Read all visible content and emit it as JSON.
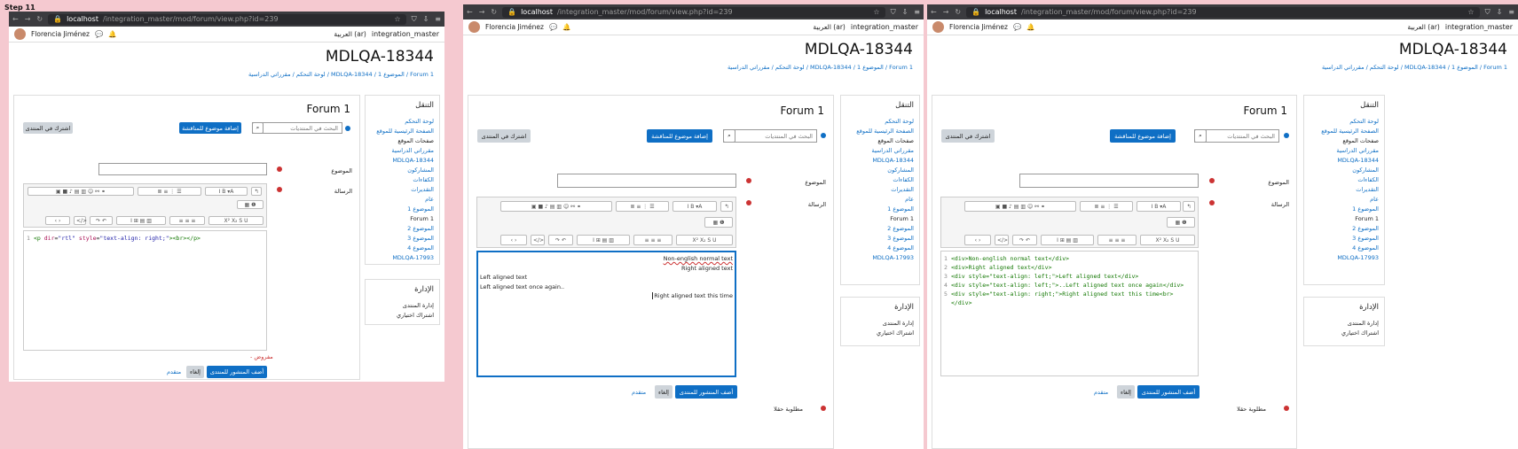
{
  "step_label": "Step 11",
  "browser": {
    "host": "localhost",
    "path": "/integration_master/mod/forum/view.php?id=239"
  },
  "user": {
    "name": "Florencia Jiménez"
  },
  "lang": "العربية (ar)",
  "site_name": "integration_master",
  "course_name": "MDLQA-18344",
  "breadcrumb": "لوحة التحكم / مقرراتي الدراسية / MDLQA-18344 / الموضوع 1 / Forum 1",
  "forum_title": "Forum 1",
  "search_placeholder": "البحث في المنتديات",
  "add_discussion": "إضافة موضوع للمناقشة",
  "subscribe": "اشترك في المنتدى",
  "subject_label": "الموضوع",
  "message_label": "الرسالة",
  "required_note": "- مفروض",
  "required_fields": "مطلوبة حقلا",
  "post_button": "أضف المنشور للمنتدى",
  "cancel_button": "إلغاء",
  "advanced_link": "متقدم",
  "nav_block": {
    "title": "التنقل",
    "items": [
      "لوحة التحكم",
      "الصفحة الرئيسية للموقع",
      "صفحات الموقع",
      "مقرراتي الدراسية",
      "MDLQA-18344",
      "المشاركون",
      "الكفاءات",
      "التقديرات",
      "عام",
      "الموضوع 1",
      "Forum 1",
      "الموضوع 2",
      "الموضوع 3",
      "الموضوع 4",
      "MDLQA-17993"
    ]
  },
  "admin_block": {
    "title": "الإدارة",
    "items": [
      "إدارة المنتدى",
      "اشتراك اختياري"
    ]
  },
  "panel1_code": [
    "<p dir=\"rtl\" style=\"text-align: right;\"><br></p>"
  ],
  "panel2_wysiwyg": {
    "line1": "Non-english normal text",
    "line2": "Right aligned text",
    "line3": "Left aligned text",
    "line4": "Left aligned text once again..",
    "line5": "Right aligned text this time"
  },
  "panel3_code": [
    "<div>Non-english normal text</div>",
    "<div>Right aligned text</div>",
    "<div style=\"text-align: left;\">Left aligned text</div>",
    "<div style=\"text-align: left;\">..Left aligned text once again</div>",
    "<div style=\"text-align: right;\">Right aligned text this time<br>",
    "</div>"
  ]
}
